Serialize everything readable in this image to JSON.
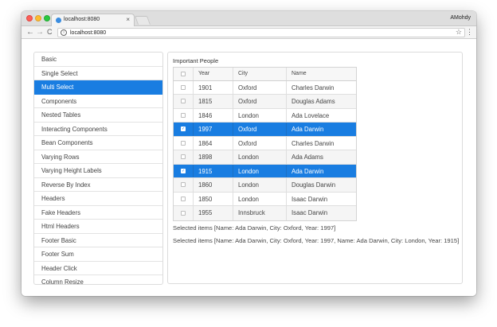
{
  "browser": {
    "tab_title": "localhost:8080",
    "tab_close": "×",
    "profile": "AMohdy",
    "url": "localhost:8080",
    "back": "←",
    "forward": "→",
    "reload": "C",
    "star": "☆",
    "menu": "⋮"
  },
  "sidebar": {
    "items": [
      {
        "label": "Basic"
      },
      {
        "label": "Single Select"
      },
      {
        "label": "Multi Select"
      },
      {
        "label": "Components"
      },
      {
        "label": "Nested Tables"
      },
      {
        "label": "Interacting Components"
      },
      {
        "label": "Bean Components"
      },
      {
        "label": "Varying Rows"
      },
      {
        "label": "Varying Height Labels"
      },
      {
        "label": "Reverse By Index"
      },
      {
        "label": "Headers"
      },
      {
        "label": "Fake Headers"
      },
      {
        "label": "Html Headers"
      },
      {
        "label": "Footer Basic"
      },
      {
        "label": "Footer Sum"
      },
      {
        "label": "Header Click"
      },
      {
        "label": "Column Resize"
      }
    ],
    "active_index": 2
  },
  "grid": {
    "caption": "Important People",
    "columns": {
      "year": "Year",
      "city": "City",
      "name": "Name"
    },
    "rows": [
      {
        "year": "1901",
        "city": "Oxford",
        "name": "Charles Darwin",
        "selected": false
      },
      {
        "year": "1815",
        "city": "Oxford",
        "name": "Douglas Adams",
        "selected": false
      },
      {
        "year": "1846",
        "city": "London",
        "name": "Ada Lovelace",
        "selected": false
      },
      {
        "year": "1997",
        "city": "Oxford",
        "name": "Ada Darwin",
        "selected": true
      },
      {
        "year": "1864",
        "city": "Oxford",
        "name": "Charles Darwin",
        "selected": false
      },
      {
        "year": "1898",
        "city": "London",
        "name": "Ada Adams",
        "selected": false
      },
      {
        "year": "1915",
        "city": "London",
        "name": "Ada Darwin",
        "selected": true
      },
      {
        "year": "1860",
        "city": "London",
        "name": "Douglas Darwin",
        "selected": false
      },
      {
        "year": "1850",
        "city": "London",
        "name": "Isaac Darwin",
        "selected": false
      },
      {
        "year": "1955",
        "city": "Innsbruck",
        "name": "Isaac Darwin",
        "selected": false
      }
    ]
  },
  "status": {
    "line1": "Selected items [Name: Ada Darwin, City: Oxford, Year: 1997]",
    "line2": "Selected items [Name: Ada Darwin, City: Oxford, Year: 1997, Name: Ada Darwin, City: London, Year: 1915]"
  },
  "colors": {
    "accent": "#197de1"
  }
}
